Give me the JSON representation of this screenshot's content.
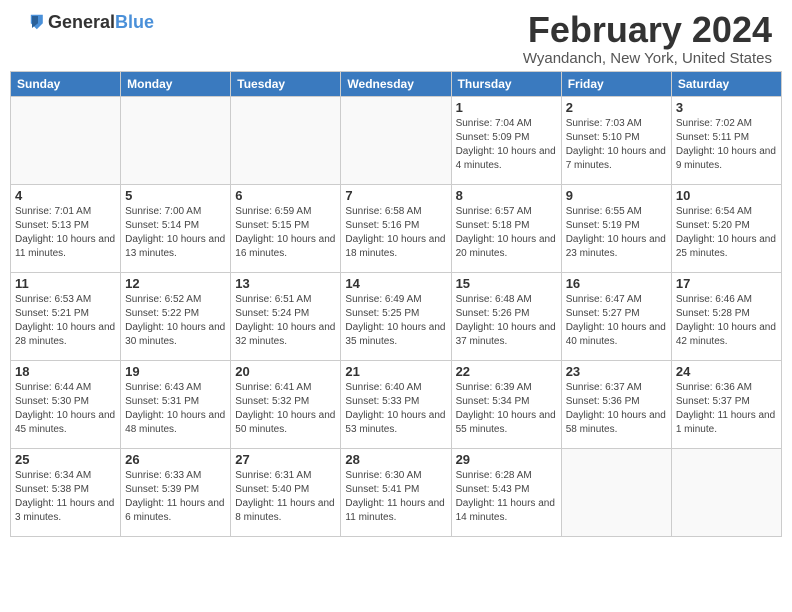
{
  "header": {
    "logo_general": "General",
    "logo_blue": "Blue",
    "month_title": "February 2024",
    "location": "Wyandanch, New York, United States"
  },
  "weekdays": [
    "Sunday",
    "Monday",
    "Tuesday",
    "Wednesday",
    "Thursday",
    "Friday",
    "Saturday"
  ],
  "weeks": [
    [
      {
        "day": "",
        "info": ""
      },
      {
        "day": "",
        "info": ""
      },
      {
        "day": "",
        "info": ""
      },
      {
        "day": "",
        "info": ""
      },
      {
        "day": "1",
        "info": "Sunrise: 7:04 AM\nSunset: 5:09 PM\nDaylight: 10 hours\nand 4 minutes."
      },
      {
        "day": "2",
        "info": "Sunrise: 7:03 AM\nSunset: 5:10 PM\nDaylight: 10 hours\nand 7 minutes."
      },
      {
        "day": "3",
        "info": "Sunrise: 7:02 AM\nSunset: 5:11 PM\nDaylight: 10 hours\nand 9 minutes."
      }
    ],
    [
      {
        "day": "4",
        "info": "Sunrise: 7:01 AM\nSunset: 5:13 PM\nDaylight: 10 hours\nand 11 minutes."
      },
      {
        "day": "5",
        "info": "Sunrise: 7:00 AM\nSunset: 5:14 PM\nDaylight: 10 hours\nand 13 minutes."
      },
      {
        "day": "6",
        "info": "Sunrise: 6:59 AM\nSunset: 5:15 PM\nDaylight: 10 hours\nand 16 minutes."
      },
      {
        "day": "7",
        "info": "Sunrise: 6:58 AM\nSunset: 5:16 PM\nDaylight: 10 hours\nand 18 minutes."
      },
      {
        "day": "8",
        "info": "Sunrise: 6:57 AM\nSunset: 5:18 PM\nDaylight: 10 hours\nand 20 minutes."
      },
      {
        "day": "9",
        "info": "Sunrise: 6:55 AM\nSunset: 5:19 PM\nDaylight: 10 hours\nand 23 minutes."
      },
      {
        "day": "10",
        "info": "Sunrise: 6:54 AM\nSunset: 5:20 PM\nDaylight: 10 hours\nand 25 minutes."
      }
    ],
    [
      {
        "day": "11",
        "info": "Sunrise: 6:53 AM\nSunset: 5:21 PM\nDaylight: 10 hours\nand 28 minutes."
      },
      {
        "day": "12",
        "info": "Sunrise: 6:52 AM\nSunset: 5:22 PM\nDaylight: 10 hours\nand 30 minutes."
      },
      {
        "day": "13",
        "info": "Sunrise: 6:51 AM\nSunset: 5:24 PM\nDaylight: 10 hours\nand 32 minutes."
      },
      {
        "day": "14",
        "info": "Sunrise: 6:49 AM\nSunset: 5:25 PM\nDaylight: 10 hours\nand 35 minutes."
      },
      {
        "day": "15",
        "info": "Sunrise: 6:48 AM\nSunset: 5:26 PM\nDaylight: 10 hours\nand 37 minutes."
      },
      {
        "day": "16",
        "info": "Sunrise: 6:47 AM\nSunset: 5:27 PM\nDaylight: 10 hours\nand 40 minutes."
      },
      {
        "day": "17",
        "info": "Sunrise: 6:46 AM\nSunset: 5:28 PM\nDaylight: 10 hours\nand 42 minutes."
      }
    ],
    [
      {
        "day": "18",
        "info": "Sunrise: 6:44 AM\nSunset: 5:30 PM\nDaylight: 10 hours\nand 45 minutes."
      },
      {
        "day": "19",
        "info": "Sunrise: 6:43 AM\nSunset: 5:31 PM\nDaylight: 10 hours\nand 48 minutes."
      },
      {
        "day": "20",
        "info": "Sunrise: 6:41 AM\nSunset: 5:32 PM\nDaylight: 10 hours\nand 50 minutes."
      },
      {
        "day": "21",
        "info": "Sunrise: 6:40 AM\nSunset: 5:33 PM\nDaylight: 10 hours\nand 53 minutes."
      },
      {
        "day": "22",
        "info": "Sunrise: 6:39 AM\nSunset: 5:34 PM\nDaylight: 10 hours\nand 55 minutes."
      },
      {
        "day": "23",
        "info": "Sunrise: 6:37 AM\nSunset: 5:36 PM\nDaylight: 10 hours\nand 58 minutes."
      },
      {
        "day": "24",
        "info": "Sunrise: 6:36 AM\nSunset: 5:37 PM\nDaylight: 11 hours\nand 1 minute."
      }
    ],
    [
      {
        "day": "25",
        "info": "Sunrise: 6:34 AM\nSunset: 5:38 PM\nDaylight: 11 hours\nand 3 minutes."
      },
      {
        "day": "26",
        "info": "Sunrise: 6:33 AM\nSunset: 5:39 PM\nDaylight: 11 hours\nand 6 minutes."
      },
      {
        "day": "27",
        "info": "Sunrise: 6:31 AM\nSunset: 5:40 PM\nDaylight: 11 hours\nand 8 minutes."
      },
      {
        "day": "28",
        "info": "Sunrise: 6:30 AM\nSunset: 5:41 PM\nDaylight: 11 hours\nand 11 minutes."
      },
      {
        "day": "29",
        "info": "Sunrise: 6:28 AM\nSunset: 5:43 PM\nDaylight: 11 hours\nand 14 minutes."
      },
      {
        "day": "",
        "info": ""
      },
      {
        "day": "",
        "info": ""
      }
    ]
  ]
}
